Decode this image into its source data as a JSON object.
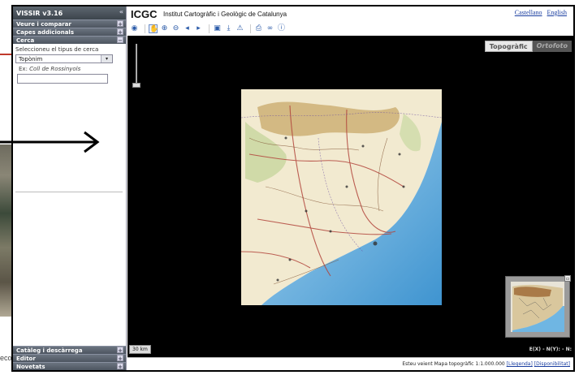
{
  "panel": {
    "title": "VISSIR v3.16",
    "collapse_glyph": "«",
    "accordions_top": [
      {
        "label": "Veure i comparar",
        "toggle": "+"
      },
      {
        "label": "Capes addicionals",
        "toggle": "+"
      },
      {
        "label": "Cerca",
        "toggle": "−"
      }
    ],
    "cerca": {
      "select_label": "Seleccioneu el tipus de cerca",
      "select_value": "Topònim",
      "example_prefix": "Ex:",
      "example_value": "Coll de Rossinyols",
      "input_value": ""
    },
    "accordions_bottom": [
      {
        "label": "Catàleg i descàrrega",
        "toggle": "+"
      },
      {
        "label": "Editor",
        "toggle": "+"
      },
      {
        "label": "Novetats",
        "toggle": "+"
      }
    ]
  },
  "header": {
    "logo": "ICGC",
    "org_name": "Institut Cartogràfic i Geològic de Catalunya",
    "lang_es": "Castellano",
    "lang_en": "English"
  },
  "toolbar": {
    "icons": [
      "globe-icon",
      "pan-hand-icon",
      "zoom-in-icon",
      "zoom-out-icon",
      "previous-icon",
      "next-icon",
      "save-icon",
      "download-icon",
      "warning-icon",
      "print-icon",
      "link-icon",
      "help-icon"
    ]
  },
  "map": {
    "basemap_topo": "Topogràfic",
    "basemap_orto": "Ortofoto",
    "scale_label": "30 km",
    "coords_label": "E(X) - N(Y): - N:",
    "colors": {
      "sea": "#6fb6e3",
      "land": "#f2ead0",
      "mountain": "#c8a86a"
    }
  },
  "background": {
    "edge_text": "eco"
  },
  "status": {
    "text": "Esteu veient Mapa topogràfic 1:1.000.000",
    "link_legend": "[Llegenda]",
    "link_availability": "[Disponibilitat]"
  }
}
